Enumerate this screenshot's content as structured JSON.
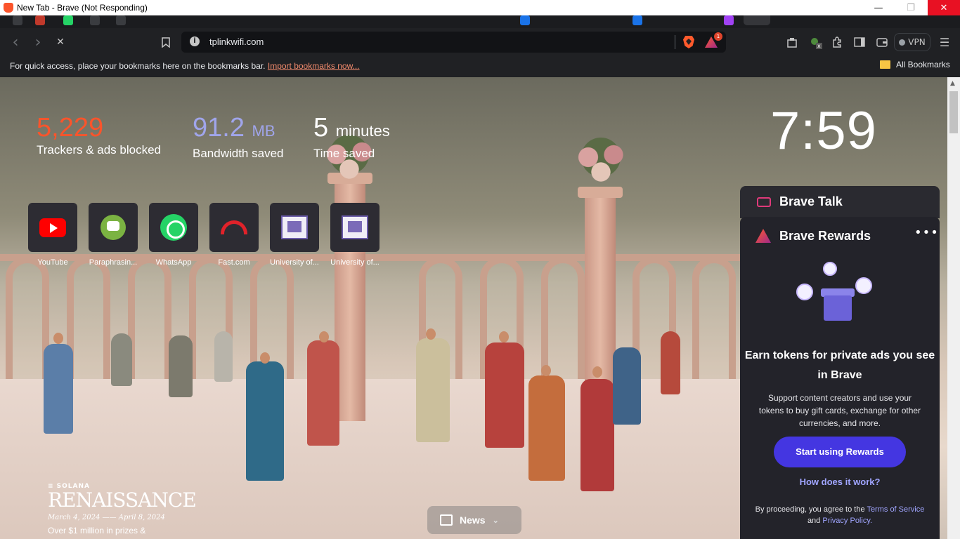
{
  "window": {
    "title": "New Tab - Brave (Not Responding)",
    "minimize": "—",
    "maximize": "❐",
    "close": "✕"
  },
  "toolbar": {
    "back": "‹",
    "forward": "›",
    "stop": "✕",
    "url": "tplinkwifi.com",
    "rewards_badge": "1",
    "vpn_label": "VPN",
    "extension_badge": "x"
  },
  "bookmarks_bar": {
    "hint_text": "For quick access, place your bookmarks here on the bookmarks bar.",
    "import_link": "Import bookmarks now...",
    "all_bookmarks": "All Bookmarks"
  },
  "stats": {
    "trackers_value": "5,229",
    "trackers_label": "Trackers & ads blocked",
    "trackers_color": "#fb542b",
    "bandwidth_value": "91.2",
    "bandwidth_unit": "MB",
    "bandwidth_label": "Bandwidth saved",
    "bandwidth_color": "#a0a5eb",
    "time_value": "5",
    "time_unit": "minutes",
    "time_label": "Time saved"
  },
  "clock": "7:59",
  "top_sites": [
    {
      "label": "YouTube",
      "icon": "youtube-icon"
    },
    {
      "label": "Paraphrasin...",
      "icon": "paraphrasing-icon"
    },
    {
      "label": "WhatsApp",
      "icon": "whatsapp-icon"
    },
    {
      "label": "Fast.com",
      "icon": "fast-icon"
    },
    {
      "label": "University of...",
      "icon": "university-icon"
    },
    {
      "label": "University of...",
      "icon": "university-icon"
    }
  ],
  "brave_talk": {
    "title": "Brave Talk"
  },
  "brave_rewards": {
    "title": "Brave Rewards",
    "more": "•••",
    "headline": "Earn tokens for private ads you see in Brave",
    "description": "Support content creators and use your tokens to buy gift cards, exchange for other currencies, and more.",
    "cta": "Start using Rewards",
    "how_link": "How does it work?",
    "terms_prefix": "By proceeding, you agree to the",
    "terms_link": "Terms of Service",
    "terms_and": "and",
    "privacy_link": "Privacy Policy."
  },
  "sponsored": {
    "brand": "≡ SOLANA",
    "name": "RENAISSANCE",
    "dates": "March 4, 2024 —— April 8, 2024",
    "tagline": "Over $1 million in prizes &"
  },
  "news": {
    "label": "News"
  }
}
